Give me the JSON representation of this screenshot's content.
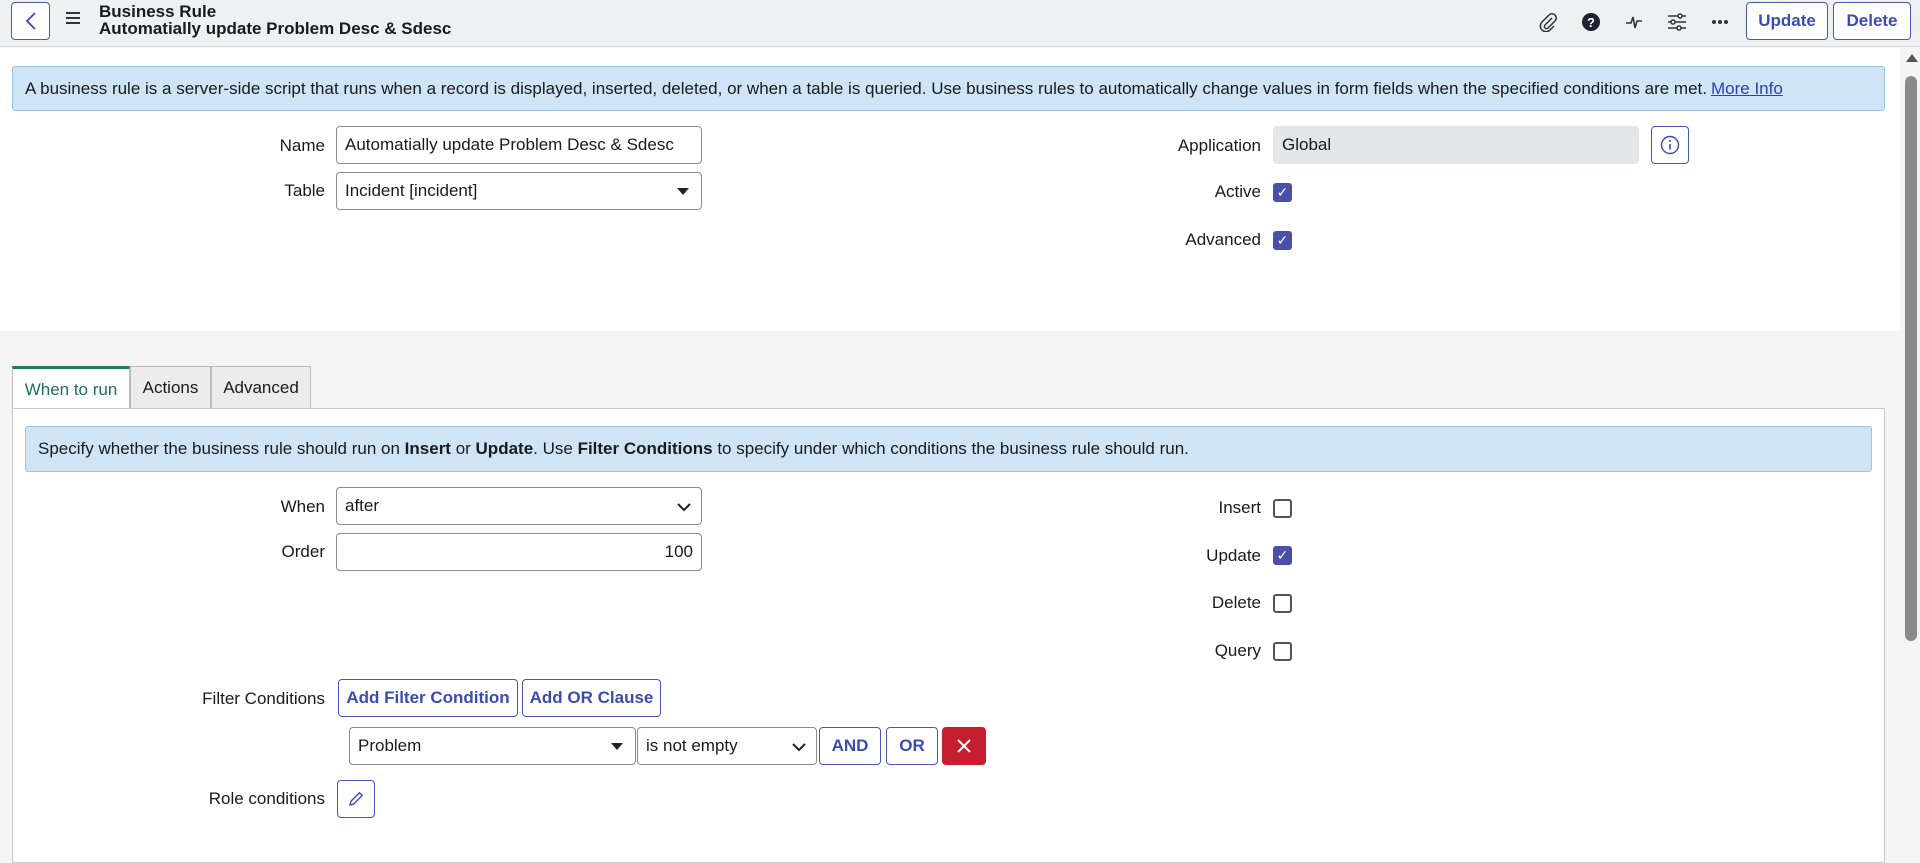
{
  "header": {
    "title_line1": "Business Rule",
    "title_line2": "Automatially update Problem Desc & Sdesc",
    "update_label": "Update",
    "delete_label": "Delete",
    "icons": [
      "chevron-left-icon",
      "hamburger-icon",
      "paperclip-icon",
      "help-icon",
      "activity-icon",
      "settings-sliders-icon",
      "more-icon"
    ]
  },
  "top_banner": {
    "text": "A business rule is a server-side script that runs when a record is displayed, inserted, deleted, or when a table is queried. Use business rules to automatically change values in form fields when the specified conditions are met.",
    "link": "More Info"
  },
  "form": {
    "name_label": "Name",
    "name_value": "Automatially update Problem Desc & Sdesc",
    "table_label": "Table",
    "table_value": "Incident [incident]",
    "application_label": "Application",
    "application_value": "Global",
    "active_label": "Active",
    "active_checked": true,
    "advanced_label": "Advanced",
    "advanced_checked": true
  },
  "tabs": [
    {
      "label": "When to run",
      "active": true
    },
    {
      "label": "Actions",
      "active": false
    },
    {
      "label": "Advanced",
      "active": false
    }
  ],
  "when_to_run": {
    "banner_parts": [
      "Specify whether the business rule should run on ",
      "Insert",
      " or ",
      "Update",
      ". Use ",
      "Filter Conditions",
      " to specify under which conditions the business rule should run."
    ],
    "when_label": "When",
    "when_value": "after",
    "order_label": "Order",
    "order_value": "100",
    "insert_label": "Insert",
    "insert_checked": false,
    "update_label": "Update",
    "update_checked": true,
    "delete_label": "Delete",
    "delete_checked": false,
    "query_label": "Query",
    "query_checked": false,
    "filter_label": "Filter Conditions",
    "add_filter_label": "Add Filter Condition",
    "add_or_label": "Add OR Clause",
    "condition_field": "Problem",
    "condition_operator": "is not empty",
    "and_label": "AND",
    "or_label": "OR",
    "role_label": "Role conditions"
  },
  "colors": {
    "accent": "#3d4bb0",
    "banner_bg": "#cfe5f6",
    "checkbox_on": "#4a4fa9",
    "delete_red": "#c41e2f",
    "tab_active": "#1f7a62"
  }
}
